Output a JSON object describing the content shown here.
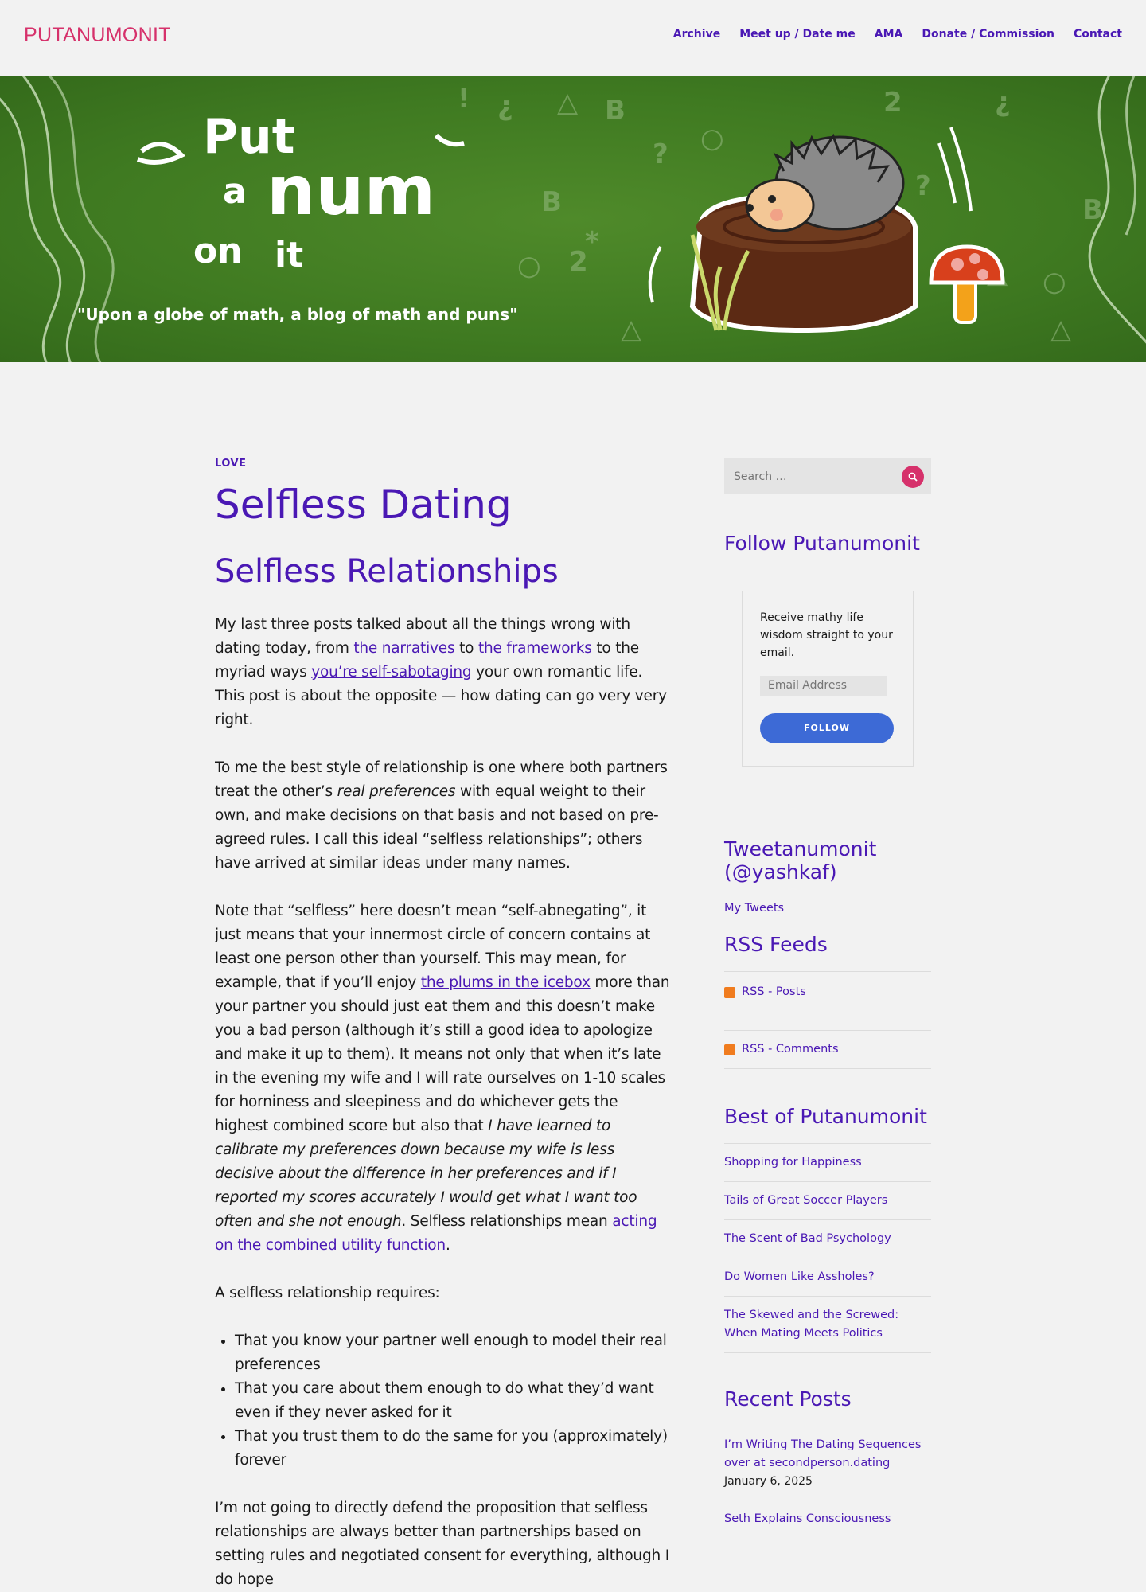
{
  "header": {
    "site_title": "PUTANUMONIT",
    "nav": [
      "Archive",
      "Meet up / Date me",
      "AMA",
      "Donate / Commission",
      "Contact"
    ]
  },
  "banner": {
    "logo_words": [
      "Put",
      "a",
      "num",
      "on",
      "it"
    ],
    "tagline": "\"Upon a globe of math, a blog of math and puns\""
  },
  "article": {
    "category": "LOVE",
    "title": "Selfless Dating",
    "subtitle": "Selfless Relationships",
    "p1": {
      "t1": "My last three posts talked about all the things wrong with dating today, from ",
      "l1": "the narratives",
      "t2": " to ",
      "l2": "the frameworks",
      "t3": " to the myriad ways ",
      "l3": "you’re self-sabotaging",
      "t4": " your own romantic life. This post is about the opposite — how dating can go very very right."
    },
    "p2": {
      "t1": "To me the best style of relationship is one where both partners treat the other’s ",
      "em": "real preferences",
      "t2": " with equal weight to their own, and make decisions on that basis and not based on pre-agreed rules. I call this ideal “selfless relationships”; others have arrived at similar ideas under many names."
    },
    "p3": {
      "t1": "Note that “selfless” here doesn’t mean “self-abnegating”, it just means that your innermost circle of concern contains at least one person other than yourself. This may mean, for example, that if you’ll enjoy ",
      "l1": "the plums in the icebox",
      "t2": " more than your partner you should just eat them and this doesn’t make you a bad person (although it’s still a good idea to apologize and make it up to them). It means not only that when it’s late in the evening my wife and I will rate ourselves on 1-10 scales for horniness and sleepiness and do whichever gets the highest combined score but also that ",
      "em": "I have learned to calibrate my preferences down because my wife is less decisive about the difference in her preferences and if I reported my scores accurately I would get what I want too often and she not enough",
      "t3": ". Selfless relationships mean ",
      "l2": "acting on the combined utility function",
      "t4": "."
    },
    "p4": "A selfless relationship requires:",
    "requirements": [
      "That you know your partner well enough to model their real preferences",
      "That you care about them enough to do what they’d want even if they never asked for it",
      "That you trust them to do the same for you (approximately) forever"
    ],
    "p5": "I’m not going to directly defend the proposition that selfless relationships are always better than partnerships based on setting rules and negotiated consent for everything, although I do hope"
  },
  "sidebar": {
    "search_placeholder": "Search …",
    "follow": {
      "title": "Follow Putanumonit",
      "text": "Receive mathy life wisdom straight to your email.",
      "email_placeholder": "Email Address",
      "button": "FOLLOW"
    },
    "tweets": {
      "title": "Tweetanumonit (@yashkaf)",
      "link": "My Tweets"
    },
    "rss": {
      "title": "RSS Feeds",
      "items": [
        "RSS - Posts",
        "RSS - Comments"
      ]
    },
    "best": {
      "title": "Best of Putanumonit",
      "items": [
        "Shopping for Happiness",
        "Tails of Great Soccer Players",
        "The Scent of Bad Psychology",
        "Do Women Like Assholes?",
        "The Skewed and the Screwed: When Mating Meets Politics"
      ]
    },
    "recent": {
      "title": "Recent Posts",
      "items": [
        {
          "title": "I’m Writing The Dating Sequences over at secondperson.dating",
          "date": "January 6, 2025"
        },
        {
          "title": "Seth Explains Consciousness",
          "date": ""
        }
      ]
    }
  },
  "colors": {
    "accent": "#4a18b4",
    "brand": "#d6316b",
    "button": "#3d6ad6",
    "banner_green": "#3f7a21"
  }
}
